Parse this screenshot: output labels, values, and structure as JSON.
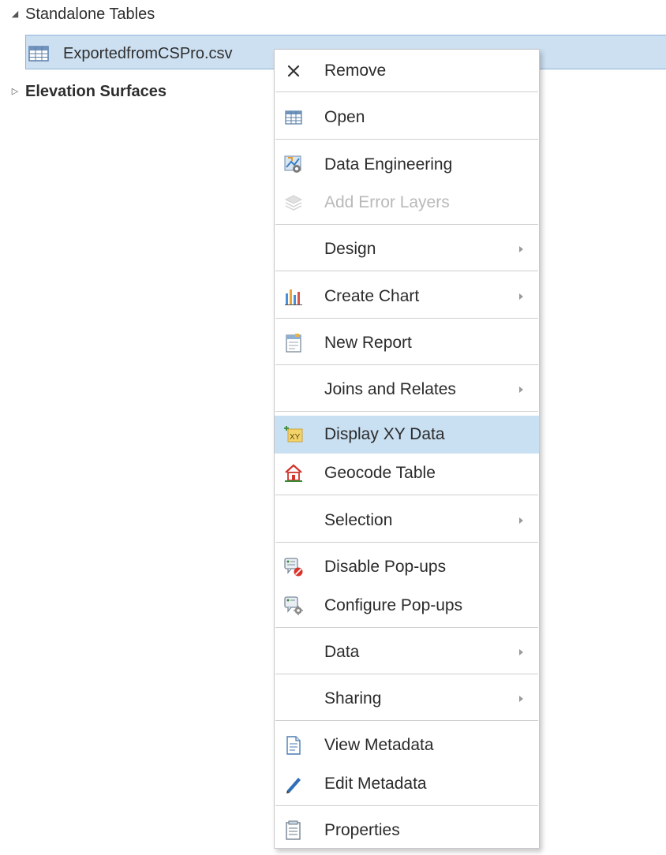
{
  "tree": {
    "standalone_tables": "Standalone Tables",
    "selected_item": "ExportedfromCSPro.csv",
    "elevation_surfaces": "Elevation Surfaces"
  },
  "menu": {
    "remove": "Remove",
    "open": "Open",
    "data_engineering": "Data Engineering",
    "add_error_layers": "Add Error Layers",
    "design": "Design",
    "create_chart": "Create Chart",
    "new_report": "New Report",
    "joins_and_relates": "Joins and Relates",
    "display_xy_data": "Display XY Data",
    "geocode_table": "Geocode Table",
    "selection": "Selection",
    "disable_popups": "Disable Pop-ups",
    "configure_popups": "Configure Pop-ups",
    "data": "Data",
    "sharing": "Sharing",
    "view_metadata": "View Metadata",
    "edit_metadata": "Edit Metadata",
    "properties": "Properties"
  },
  "icons": {
    "remove": "close-icon",
    "open": "table-icon",
    "data_engineering": "data-engineering-icon",
    "add_error_layers": "layers-icon",
    "create_chart": "bar-chart-icon",
    "new_report": "report-icon",
    "display_xy_data": "xy-data-icon",
    "geocode_table": "house-icon",
    "disable_popups": "disable-popup-icon",
    "configure_popups": "configure-popup-icon",
    "view_metadata": "document-icon",
    "edit_metadata": "pencil-icon",
    "properties": "properties-icon"
  },
  "colors": {
    "selection_background": "#cde0f2",
    "hover_background": "#c9dff2",
    "disabled_text": "#b9b9b9"
  }
}
